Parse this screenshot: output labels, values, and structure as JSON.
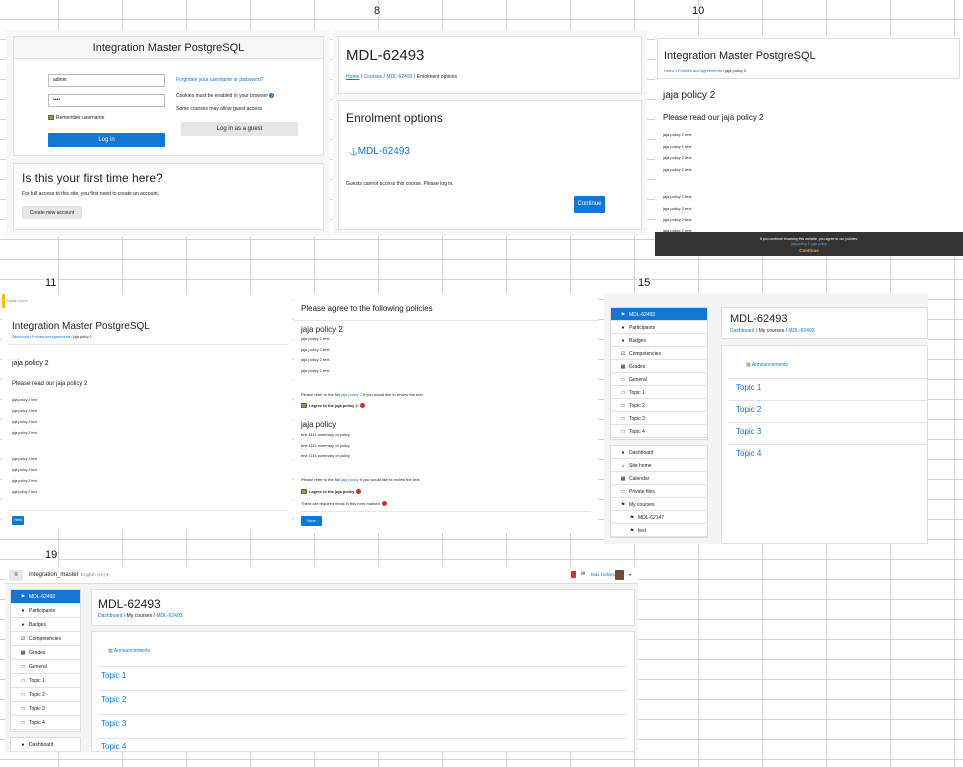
{
  "labels": {
    "n8": "8",
    "n10": "10",
    "n11": "11",
    "n15": "15",
    "n19": "19"
  },
  "login": {
    "title": "Integration Master PostgreSQL",
    "username": "admin",
    "password": "••••",
    "forgot": "Forgotten your username or password?",
    "cookies": "Cookies must be enabled in your browser",
    "guest_note": "Some courses may allow guest access",
    "remember": "Remember username",
    "login_btn": "Log in",
    "guest_btn": "Log in as a guest",
    "first_title": "Is this your first time here?",
    "first_desc": "For full access to this site, you first need to create an account.",
    "create_btn": "Create new account"
  },
  "enrol": {
    "course": "MDL-62493",
    "crumbs": [
      "Home",
      "Courses",
      "MDL-62493",
      "Enrolment options"
    ],
    "title": "Enrolment options",
    "course_link": "MDL-62493",
    "guest_msg": "Guests cannot access this course. Please log in.",
    "continue": "Continue"
  },
  "policy10": {
    "site": "Integration Master PostgreSQL",
    "crumbs": [
      "Home",
      "Policies and agreements",
      "jaja policy 2"
    ],
    "heading": "jaja policy 2",
    "read": "Please read our jaja policy 2",
    "line": "jaja policy 2 text",
    "cookie_msg": "If you continue browsing this website, you agree to our policies:",
    "cookie_link": "jaja policy 2, jaja policy",
    "cookie_btn": "Continue"
  },
  "policy11": {
    "lang": "English (en) ▾",
    "site": "Integration Master PostgreSQL",
    "crumbs": [
      "Dashboard",
      "Policies and agreements",
      "jaja policy 2"
    ],
    "heading": "jaja policy 2",
    "read": "Please read our jaja policy 2",
    "line": "jaja policy 2 text",
    "next": "Next"
  },
  "agree": {
    "title": "Please agree to the following policies",
    "p1_title": "jaja policy 2",
    "p1_line": "jaja policy 2 text",
    "p1_refer_a": "Please refer to the full ",
    "p1_refer_link": "jaja policy 2",
    "p1_refer_b": " if you would like to review the text.",
    "p1_agree": "I agree to the jaja policy 2",
    "p2_title": "jaja policy",
    "p2_line": "test 1111 summary of policy",
    "p2_refer_a": "Please refer to the full ",
    "p2_refer_link": "jaja policy",
    "p2_refer_b": " if you would like to review the text.",
    "p2_agree": "I agree to the jaja policy",
    "required": "There are required fields in this form marked",
    "next": "Next"
  },
  "course15": {
    "nav": [
      "MDL-62493",
      "Participants",
      "Badges",
      "Competencies",
      "Grades",
      "General",
      "Topic 1",
      "Topic 2",
      "Topic 3",
      "Topic 4"
    ],
    "nav2": [
      "Dashboard",
      "Site home",
      "Calendar",
      "Private files",
      "My courses",
      "MDL-62147",
      "test"
    ],
    "title": "MDL-62493",
    "crumbs": [
      "Dashboard",
      "My courses",
      "MDL-62493"
    ],
    "announcements": "Announcements",
    "topics": [
      "Topic 1",
      "Topic 2",
      "Topic 3",
      "Topic 4"
    ]
  },
  "course19": {
    "site": "integration_master",
    "lang": "English (en) ▾",
    "user": "Max Holland",
    "nav": [
      "MDL-62493",
      "Participants",
      "Badges",
      "Competencies",
      "Grades",
      "General",
      "Topic 1",
      "Topic 2",
      "Topic 3",
      "Topic 4"
    ],
    "nav2": [
      "Dashboard"
    ],
    "title": "MDL-62493",
    "crumbs": [
      "Dashboard",
      "My courses",
      "MDL-62493"
    ],
    "announcements": "Announcements",
    "topics": [
      "Topic 1",
      "Topic 2",
      "Topic 3",
      "Topic 4"
    ]
  },
  "colors": {
    "accent": "#1177d1",
    "cookie_bg": "#333333",
    "cookie_btn": "#f0ad00"
  }
}
